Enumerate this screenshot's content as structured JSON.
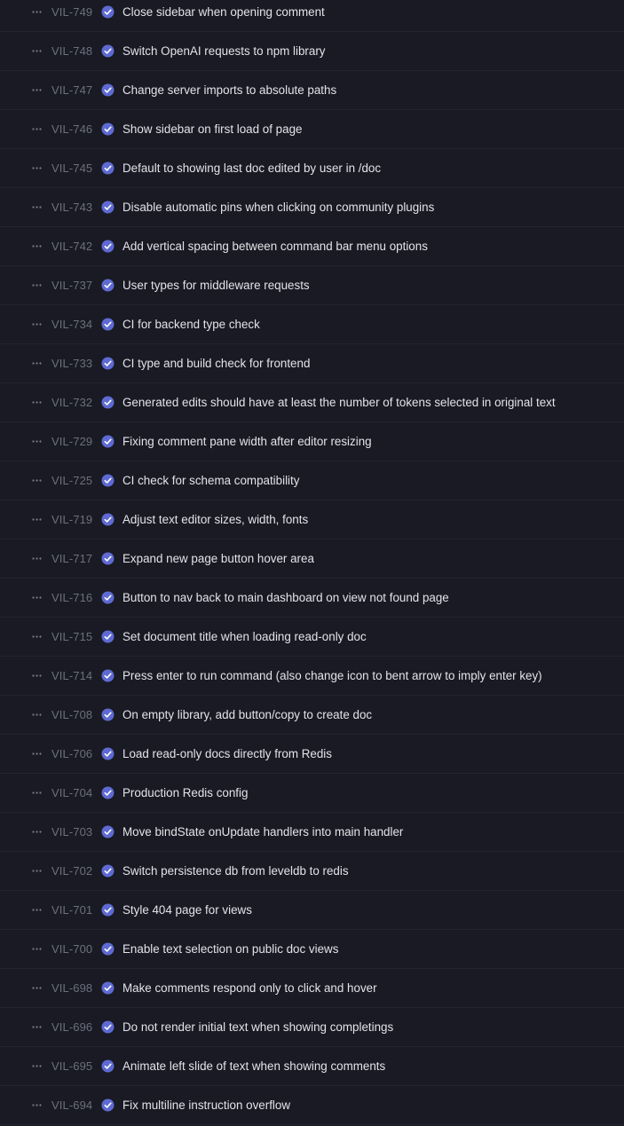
{
  "colors": {
    "background": "#191a23",
    "row_divider": "#23242f",
    "identifier_text": "#6c6f7e",
    "title_text": "#e3e4ea",
    "done_status": "#5e6ad2"
  },
  "icons": {
    "row_menu": "more-horizontal-icon",
    "status": "done-status-check-circle-icon"
  },
  "issues": [
    {
      "id": "VIL-749",
      "title": "Close sidebar when opening comment",
      "status": "done"
    },
    {
      "id": "VIL-748",
      "title": "Switch OpenAI requests to npm library",
      "status": "done"
    },
    {
      "id": "VIL-747",
      "title": "Change server imports to absolute paths",
      "status": "done"
    },
    {
      "id": "VIL-746",
      "title": "Show sidebar on first load of page",
      "status": "done"
    },
    {
      "id": "VIL-745",
      "title": "Default to showing last doc edited by user in /doc",
      "status": "done"
    },
    {
      "id": "VIL-743",
      "title": "Disable automatic pins when clicking on community plugins",
      "status": "done"
    },
    {
      "id": "VIL-742",
      "title": "Add vertical spacing between command bar menu options",
      "status": "done"
    },
    {
      "id": "VIL-737",
      "title": "User types for middleware requests",
      "status": "done"
    },
    {
      "id": "VIL-734",
      "title": "CI for backend type check",
      "status": "done"
    },
    {
      "id": "VIL-733",
      "title": "CI type and build check for frontend",
      "status": "done"
    },
    {
      "id": "VIL-732",
      "title": "Generated edits should have at least the number of tokens selected in original text",
      "status": "done"
    },
    {
      "id": "VIL-729",
      "title": "Fixing comment pane width after editor resizing",
      "status": "done"
    },
    {
      "id": "VIL-725",
      "title": "CI check for schema compatibility",
      "status": "done"
    },
    {
      "id": "VIL-719",
      "title": "Adjust text editor sizes, width, fonts",
      "status": "done"
    },
    {
      "id": "VIL-717",
      "title": "Expand new page button hover area",
      "status": "done"
    },
    {
      "id": "VIL-716",
      "title": "Button to nav back to main dashboard on view not found page",
      "status": "done"
    },
    {
      "id": "VIL-715",
      "title": "Set document title when loading read-only doc",
      "status": "done"
    },
    {
      "id": "VIL-714",
      "title": "Press enter to run command (also change icon to bent arrow to imply enter key)",
      "status": "done"
    },
    {
      "id": "VIL-708",
      "title": "On empty library, add button/copy to create doc",
      "status": "done"
    },
    {
      "id": "VIL-706",
      "title": "Load read-only docs directly from Redis",
      "status": "done"
    },
    {
      "id": "VIL-704",
      "title": "Production Redis config",
      "status": "done"
    },
    {
      "id": "VIL-703",
      "title": "Move bindState onUpdate handlers into main handler",
      "status": "done"
    },
    {
      "id": "VIL-702",
      "title": "Switch persistence db from leveldb to redis",
      "status": "done"
    },
    {
      "id": "VIL-701",
      "title": "Style 404 page for views",
      "status": "done"
    },
    {
      "id": "VIL-700",
      "title": "Enable text selection on public doc views",
      "status": "done"
    },
    {
      "id": "VIL-698",
      "title": "Make comments respond only to click and hover",
      "status": "done"
    },
    {
      "id": "VIL-696",
      "title": "Do not render initial text when showing completings",
      "status": "done"
    },
    {
      "id": "VIL-695",
      "title": "Animate left slide of text when showing comments",
      "status": "done"
    },
    {
      "id": "VIL-694",
      "title": "Fix multiline instruction overflow",
      "status": "done"
    }
  ]
}
